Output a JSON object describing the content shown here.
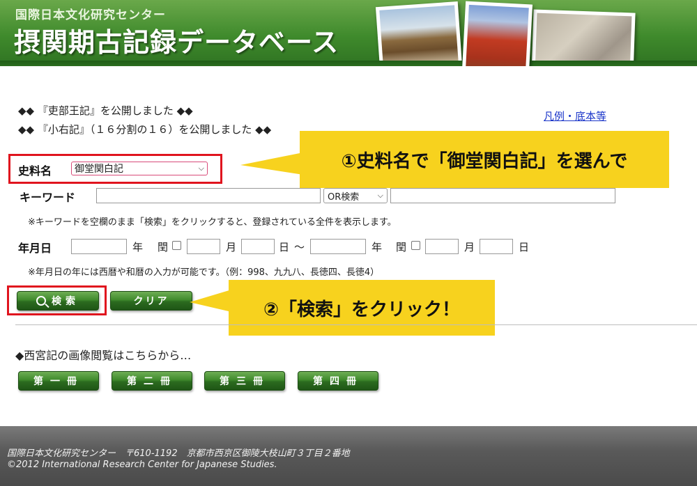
{
  "header": {
    "organization": "国際日本文化研究センター",
    "title": "摂関期古記録データベース"
  },
  "notices": [
    "◆◆ 『吏部王記』を公開しました ◆◆",
    "◆◆ 『小右記』（１６分割の１６）を公開しました ◆◆"
  ],
  "legend_link": "凡例・底本等",
  "form": {
    "title_label": "史料名",
    "title_selected": "御堂関白記",
    "keyword_label": "キーワード",
    "search_mode_selected": "OR検索",
    "keyword_note": "※キーワードを空欄のまま「検索」をクリックすると、登録されている全件を表示します。",
    "date_label": "年月日",
    "year_unit": "年",
    "leap_label": "閏",
    "month_unit": "月",
    "day_unit": "日",
    "range_sep": "〜",
    "date_note": "※年月日の年には西暦や和暦の入力が可能です。（例：998、九九八、長徳四、長徳4）",
    "search_button": "検索",
    "clear_button": "クリア"
  },
  "callouts": {
    "step1": "①史料名で「御堂関白記」を選んで",
    "step2": "②「検索」をクリック！"
  },
  "image_section": {
    "heading": "◆西宮記の画像閲覧はこちらから…",
    "volumes": [
      "第一冊",
      "第二冊",
      "第三冊",
      "第四冊"
    ]
  },
  "footer": {
    "address": "国際日本文化研究センター　〒610-1192　京都市西京区御陵大枝山町３丁目２番地",
    "copyright": "©2012 International Research Center for Japanese Studies."
  },
  "colors": {
    "header_green": "#3f8a2c",
    "callout_yellow": "#f7d21e",
    "highlight_red": "#e0141e",
    "link_blue": "#1a35c9"
  }
}
